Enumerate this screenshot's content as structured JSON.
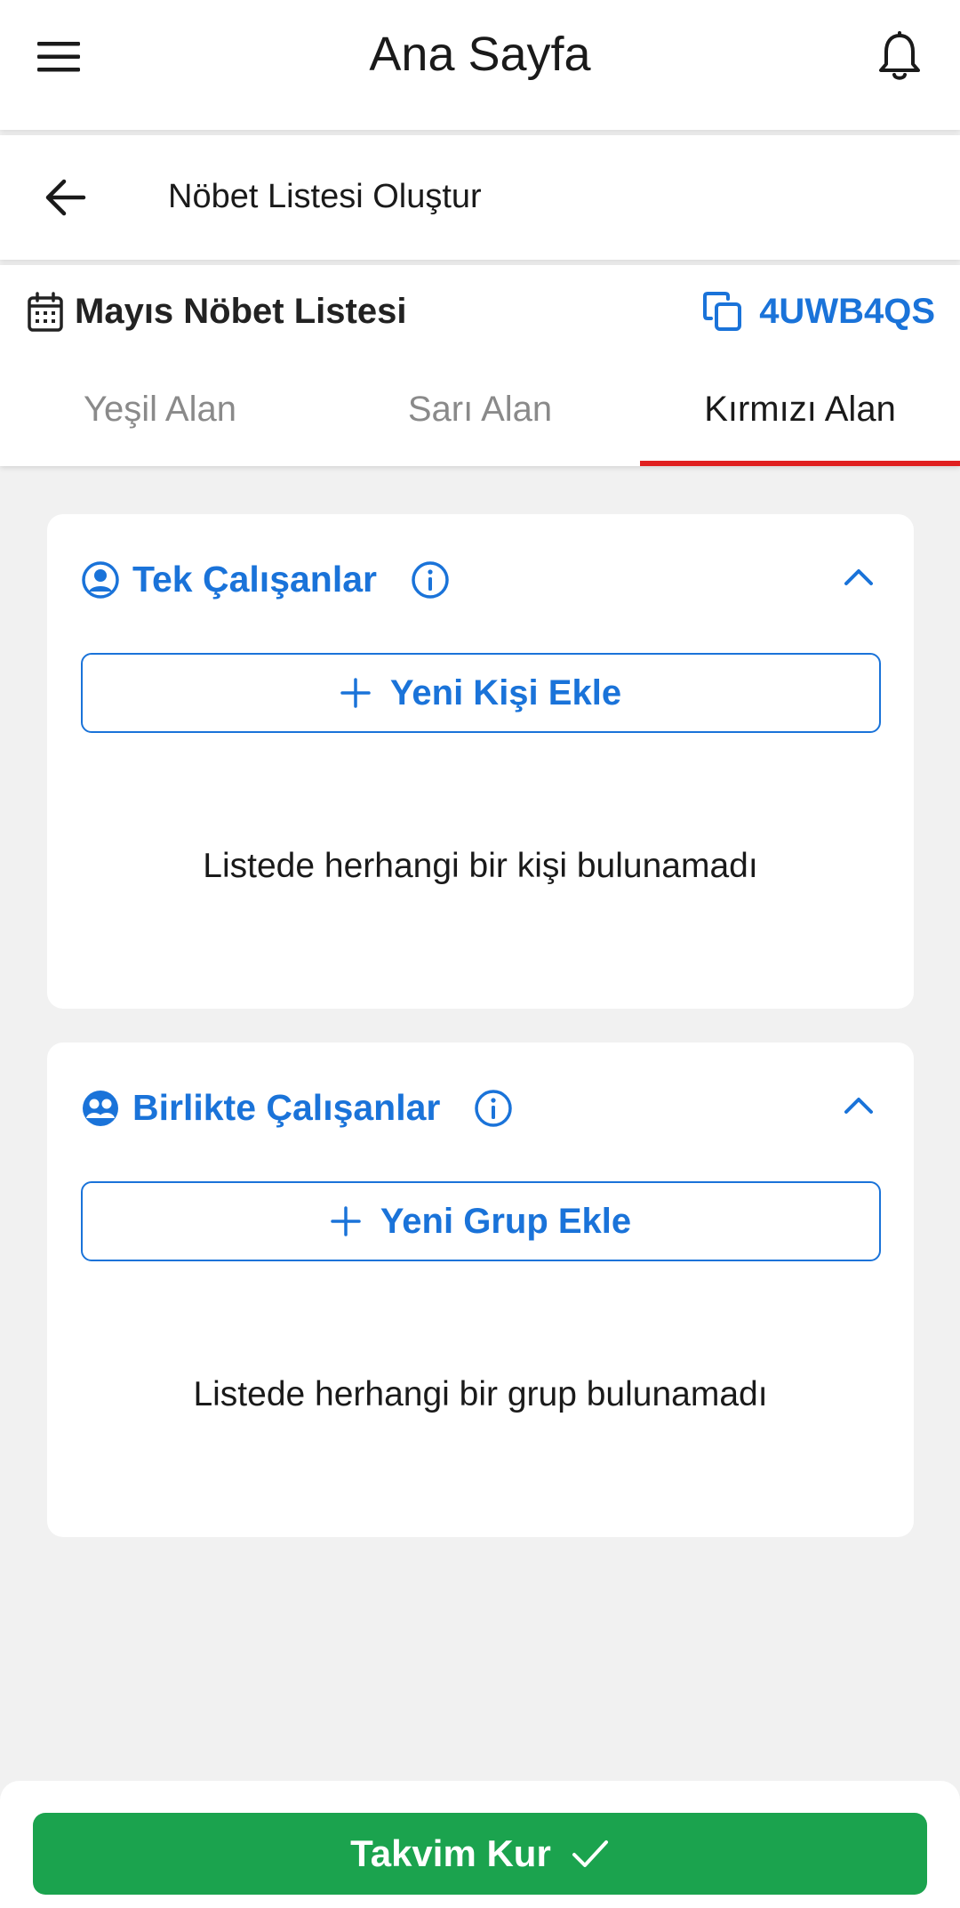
{
  "app_bar": {
    "title": "Ana Sayfa",
    "menu_icon": "menu-icon",
    "notification_icon": "bell-icon"
  },
  "sub_header": {
    "title": "Nöbet Listesi Oluştur",
    "back_icon": "arrow-left-icon"
  },
  "list_header": {
    "name": "Mayıs Nöbet Listesi",
    "code": "4UWB4QS",
    "calendar_icon": "calendar-icon",
    "copy_icon": "copy-icon"
  },
  "tabs": [
    {
      "label": "Yeşil Alan",
      "active": false
    },
    {
      "label": "Sarı Alan",
      "active": false
    },
    {
      "label": "Kırmızı Alan",
      "active": true
    }
  ],
  "sections": [
    {
      "title": "Tek Çalışanlar",
      "icon": "user-circle-icon",
      "add_label": "Yeni Kişi Ekle",
      "empty_text": "Listede herhangi bir kişi bulunamadı",
      "expanded": true
    },
    {
      "title": "Birlikte Çalışanlar",
      "icon": "group-icon",
      "add_label": "Yeni Grup Ekle",
      "empty_text": "Listede herhangi bir grup bulunamadı",
      "expanded": true
    }
  ],
  "footer": {
    "button_label": "Takvim Kur"
  },
  "colors": {
    "primary": "#1a73d9",
    "active_tab_indicator": "#e02020",
    "cta": "#1ba34e",
    "background": "#f1f1f1"
  }
}
